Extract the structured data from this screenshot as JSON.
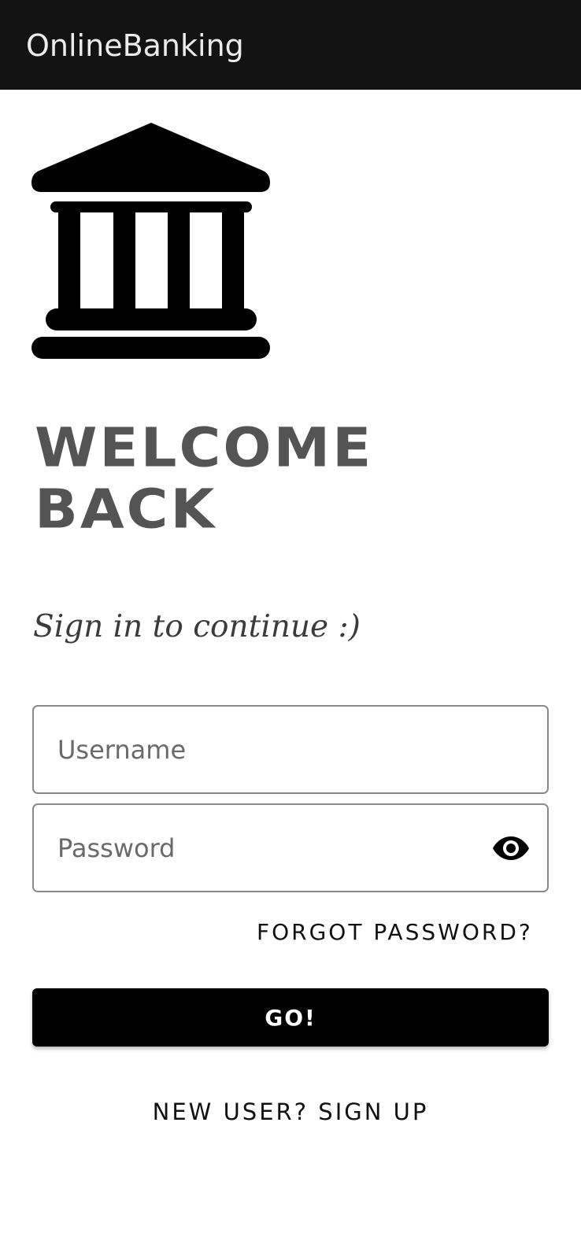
{
  "app_bar": {
    "title": "OnlineBanking"
  },
  "logo": {
    "icon": "bank-building-icon"
  },
  "welcome": {
    "line1": "WELCOME",
    "line2": "BACK"
  },
  "subtitle": "Sign in to continue :)",
  "form": {
    "username": {
      "placeholder": "Username",
      "value": ""
    },
    "password": {
      "placeholder": "Password",
      "value": "",
      "toggle_icon": "eye-icon"
    },
    "forgot_label": "FORGOT PASSWORD?",
    "submit_label": "GO!",
    "signup_label": "NEW USER? SIGN UP"
  },
  "colors": {
    "app_bar_bg": "#131313",
    "app_bar_text": "#ececec",
    "heading": "#545454",
    "button_bg": "#000000",
    "button_text": "#ffffff"
  }
}
